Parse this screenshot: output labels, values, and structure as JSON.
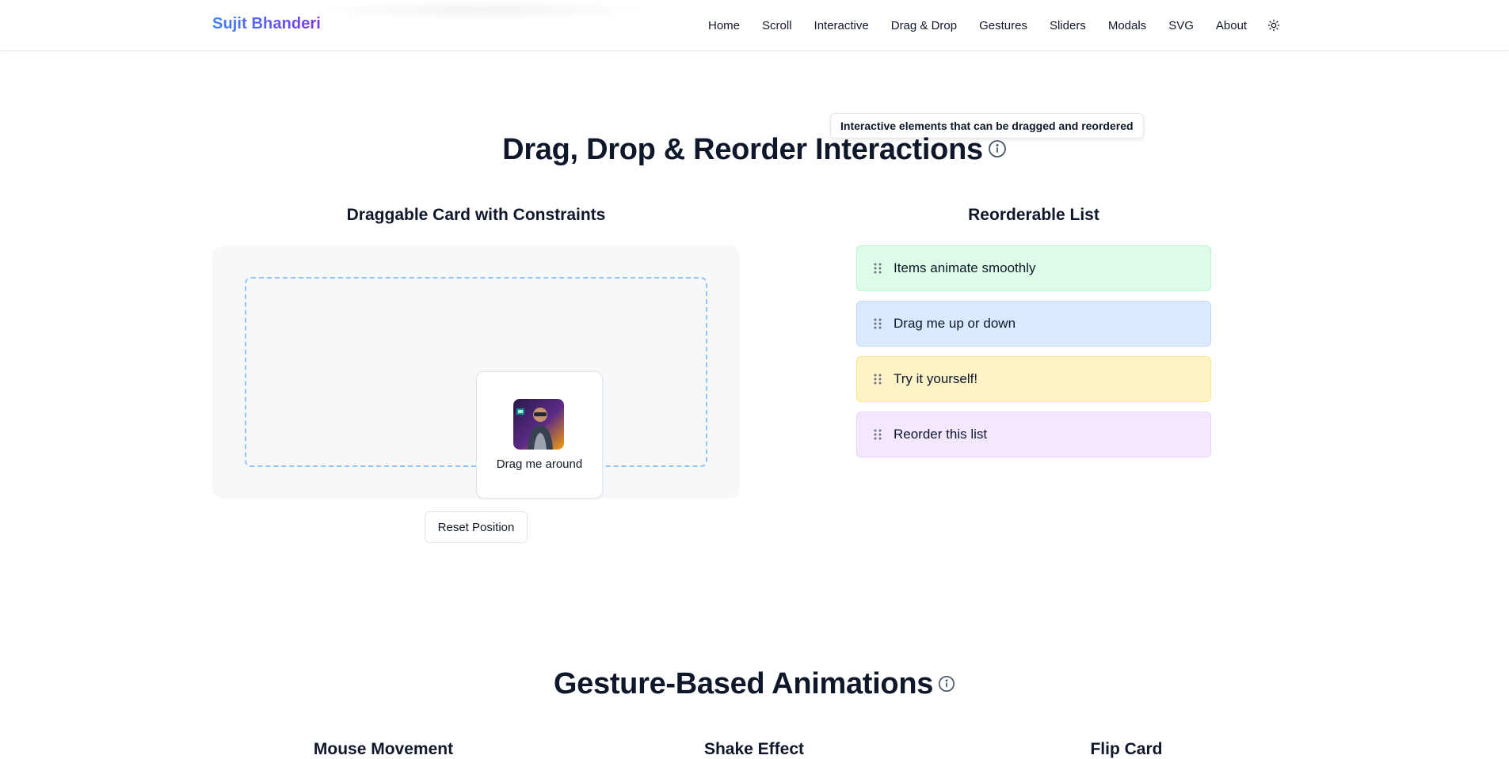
{
  "nav": {
    "brand": "Sujit Bhanderi",
    "links": [
      "Home",
      "Scroll",
      "Interactive",
      "Drag & Drop",
      "Gestures",
      "Sliders",
      "Modals",
      "SVG",
      "About"
    ],
    "theme_icon": "sun-icon"
  },
  "drag_section": {
    "tooltip": "Interactive elements that can be dragged and reordered",
    "title": "Drag, Drop & Reorder Interactions",
    "draggable": {
      "heading": "Draggable Card with Constraints",
      "card_label": "Drag me around",
      "reset_label": "Reset Position"
    },
    "reorderable": {
      "heading": "Reorderable List",
      "items": [
        "Items animate smoothly",
        "Drag me up or down",
        "Try it yourself!",
        "Reorder this list"
      ]
    }
  },
  "gesture_section": {
    "title": "Gesture-Based Animations",
    "subheadings": [
      "Mouse Movement",
      "Shake Effect",
      "Flip Card"
    ]
  },
  "colors": {
    "brand_gradient": [
      "#3b82f6",
      "#7c3aed"
    ],
    "list_item_backgrounds": [
      "#dcfce7",
      "#dbeafe",
      "#fef3c7",
      "#f3e8ff"
    ],
    "constraint_border": "#93c5fd"
  }
}
